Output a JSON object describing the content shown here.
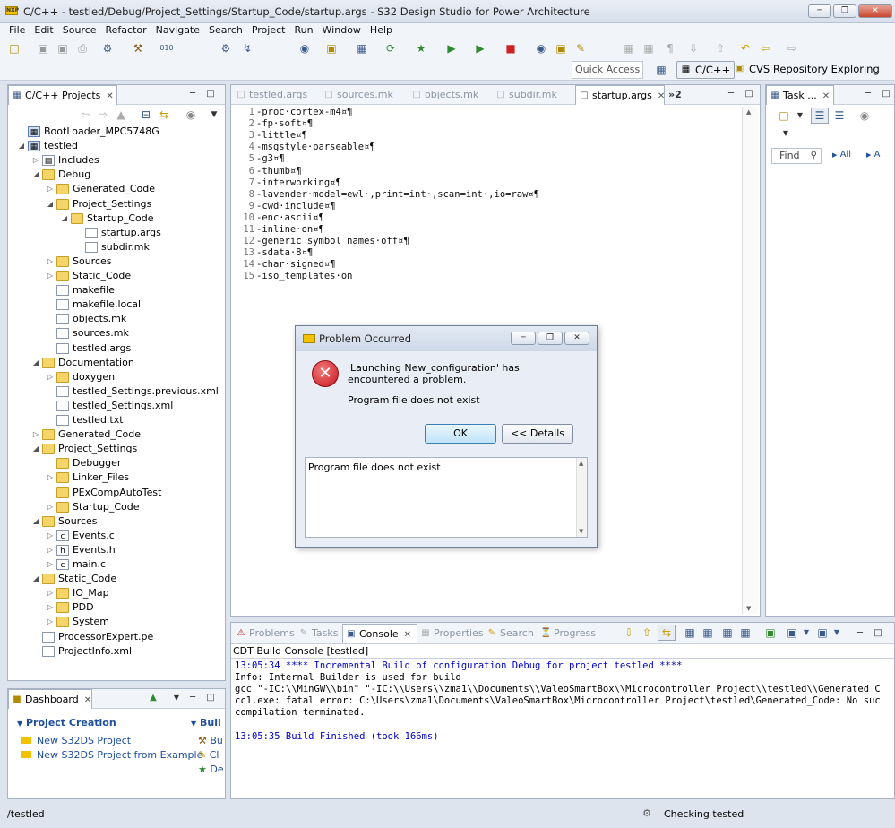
{
  "window": {
    "title": "C/C++ - testled/Debug/Project_Settings/Startup_Code/startup.args - S32 Design Studio for Power Architecture",
    "app_icon": "nxp-logo-icon"
  },
  "menu": [
    "File",
    "Edit",
    "Source",
    "Refactor",
    "Navigate",
    "Search",
    "Project",
    "Run",
    "Window",
    "Help"
  ],
  "toolbar": {
    "quick_access_placeholder": "Quick Access",
    "perspectives": [
      {
        "label": "C/C++",
        "active": true
      },
      {
        "label": "CVS Repository Exploring",
        "active": false
      }
    ]
  },
  "project_explorer": {
    "tab_label": "C/C++ Projects",
    "tree": [
      {
        "label": "BootLoader_MPC5748G",
        "depth": 0,
        "type": "project",
        "expanded": null
      },
      {
        "label": "testled",
        "depth": 0,
        "type": "project",
        "expanded": true
      },
      {
        "label": "Includes",
        "depth": 1,
        "type": "includes",
        "expanded": false
      },
      {
        "label": "Debug",
        "depth": 1,
        "type": "folder",
        "expanded": true
      },
      {
        "label": "Generated_Code",
        "depth": 2,
        "type": "folder",
        "expanded": false
      },
      {
        "label": "Project_Settings",
        "depth": 2,
        "type": "folder",
        "expanded": true
      },
      {
        "label": "Startup_Code",
        "depth": 3,
        "type": "folder",
        "expanded": true
      },
      {
        "label": "startup.args",
        "depth": 4,
        "type": "file",
        "expanded": null
      },
      {
        "label": "subdir.mk",
        "depth": 4,
        "type": "file",
        "expanded": null
      },
      {
        "label": "Sources",
        "depth": 2,
        "type": "folder",
        "expanded": false
      },
      {
        "label": "Static_Code",
        "depth": 2,
        "type": "folder",
        "expanded": false
      },
      {
        "label": "makefile",
        "depth": 2,
        "type": "file",
        "expanded": null
      },
      {
        "label": "makefile.local",
        "depth": 2,
        "type": "file",
        "expanded": null
      },
      {
        "label": "objects.mk",
        "depth": 2,
        "type": "file",
        "expanded": null
      },
      {
        "label": "sources.mk",
        "depth": 2,
        "type": "file",
        "expanded": null
      },
      {
        "label": "testled.args",
        "depth": 2,
        "type": "file",
        "expanded": null
      },
      {
        "label": "Documentation",
        "depth": 1,
        "type": "folder",
        "expanded": true
      },
      {
        "label": "doxygen",
        "depth": 2,
        "type": "folder",
        "expanded": false
      },
      {
        "label": "testled_Settings.previous.xml",
        "depth": 2,
        "type": "file",
        "expanded": null
      },
      {
        "label": "testled_Settings.xml",
        "depth": 2,
        "type": "file",
        "expanded": null
      },
      {
        "label": "testled.txt",
        "depth": 2,
        "type": "file",
        "expanded": null
      },
      {
        "label": "Generated_Code",
        "depth": 1,
        "type": "folder",
        "expanded": false
      },
      {
        "label": "Project_Settings",
        "depth": 1,
        "type": "folder",
        "expanded": true
      },
      {
        "label": "Debugger",
        "depth": 2,
        "type": "folder",
        "expanded": null
      },
      {
        "label": "Linker_Files",
        "depth": 2,
        "type": "folder",
        "expanded": false
      },
      {
        "label": "PExCompAutoTest",
        "depth": 2,
        "type": "folder",
        "expanded": null
      },
      {
        "label": "Startup_Code",
        "depth": 2,
        "type": "folder",
        "expanded": false
      },
      {
        "label": "Sources",
        "depth": 1,
        "type": "folder",
        "expanded": true
      },
      {
        "label": "Events.c",
        "depth": 2,
        "type": "cfile",
        "expanded": false
      },
      {
        "label": "Events.h",
        "depth": 2,
        "type": "hfile",
        "expanded": false
      },
      {
        "label": "main.c",
        "depth": 2,
        "type": "cfile",
        "expanded": false
      },
      {
        "label": "Static_Code",
        "depth": 1,
        "type": "folder",
        "expanded": true
      },
      {
        "label": "IO_Map",
        "depth": 2,
        "type": "folder",
        "expanded": false
      },
      {
        "label": "PDD",
        "depth": 2,
        "type": "folder",
        "expanded": false
      },
      {
        "label": "System",
        "depth": 2,
        "type": "folder",
        "expanded": false
      },
      {
        "label": "ProcessorExpert.pe",
        "depth": 1,
        "type": "file",
        "expanded": null
      },
      {
        "label": "ProjectInfo.xml",
        "depth": 1,
        "type": "file",
        "expanded": null
      }
    ]
  },
  "dashboard": {
    "tab_label": "Dashboard",
    "section_project_creation": "Project Creation",
    "section_build": "Buil",
    "links": [
      "New S32DS Project",
      "New S32DS Project from Example"
    ],
    "build_items": [
      "Bu",
      "Cl",
      "De"
    ]
  },
  "editor": {
    "tabs": [
      {
        "label": "testled.args",
        "active": false
      },
      {
        "label": "sources.mk",
        "active": false
      },
      {
        "label": "objects.mk",
        "active": false
      },
      {
        "label": "subdir.mk",
        "active": false
      },
      {
        "label": "startup.args",
        "active": true
      }
    ],
    "overflow_label": "»2",
    "lines": [
      {
        "n": "1",
        "text": "-proc·cortex-m4¤¶"
      },
      {
        "n": "2",
        "text": "-fp·soft¤¶"
      },
      {
        "n": "3",
        "text": "-little¤¶"
      },
      {
        "n": "4",
        "text": "-msgstyle·parseable¤¶"
      },
      {
        "n": "5",
        "text": "-g3¤¶"
      },
      {
        "n": "6",
        "text": "-thumb¤¶"
      },
      {
        "n": "7",
        "text": "-interworking¤¶"
      },
      {
        "n": "8",
        "text": "-lavender·model=ewl·,print=int·,scan=int·,io=raw¤¶"
      },
      {
        "n": "9",
        "text": "-cwd·include¤¶"
      },
      {
        "n": "10",
        "text": "-enc·ascii¤¶"
      },
      {
        "n": "11",
        "text": "-inline·on¤¶"
      },
      {
        "n": "12",
        "text": "-generic_symbol_names·off¤¶"
      },
      {
        "n": "13",
        "text": "-sdata·8¤¶"
      },
      {
        "n": "14",
        "text": "-char·signed¤¶"
      },
      {
        "n": "15",
        "text": "-iso_templates·on"
      }
    ]
  },
  "task_panel": {
    "tab_label": "Task ...",
    "find_placeholder": "Find",
    "all_label": "All",
    "a_label": "A"
  },
  "bottom_panel": {
    "tabs": [
      {
        "label": "Problems",
        "active": false
      },
      {
        "label": "Tasks",
        "active": false
      },
      {
        "label": "Console",
        "active": true
      },
      {
        "label": "Properties",
        "active": false
      },
      {
        "label": "Search",
        "active": false
      },
      {
        "label": "Progress",
        "active": false
      }
    ],
    "console_title": "CDT Build Console [testled]",
    "console_lines": [
      {
        "text": "13:05:34 **** Incremental Build of configuration Debug for project testled ****",
        "color": "#0000c8"
      },
      {
        "text": "Info: Internal Builder is used for build",
        "color": "#000000"
      },
      {
        "text": "gcc \"-IC:\\\\MinGW\\\\bin\" \"-IC:\\\\Users\\\\zma1\\\\Documents\\\\ValeoSmartBox\\\\Microcontroller Project\\\\testled\\\\Generated_C",
        "color": "#000000"
      },
      {
        "text": "cc1.exe: fatal error: C:\\Users\\zma1\\Documents\\ValeoSmartBox\\Microcontroller Project\\testled\\Generated_Code: No suc",
        "color": "#000000"
      },
      {
        "text": "compilation terminated.",
        "color": "#000000"
      },
      {
        "text": "",
        "color": "#000000"
      },
      {
        "text": "13:05:35 Build Finished (took 166ms)",
        "color": "#0000c8"
      }
    ]
  },
  "dialog": {
    "title": "Problem Occurred",
    "message": "'Launching New_configuration' has encountered a problem.",
    "detail": "Program file does not exist",
    "ok_label": "OK",
    "details_label": "<< Details",
    "details_text": "Program file does not exist"
  },
  "status": {
    "path": "/testled",
    "job": "Checking tested"
  },
  "colors": {
    "accent": "#3c7fb1",
    "error_red": "#d21f26",
    "console_blue": "#0000c8",
    "folder_yellow": "#f5d46a"
  }
}
